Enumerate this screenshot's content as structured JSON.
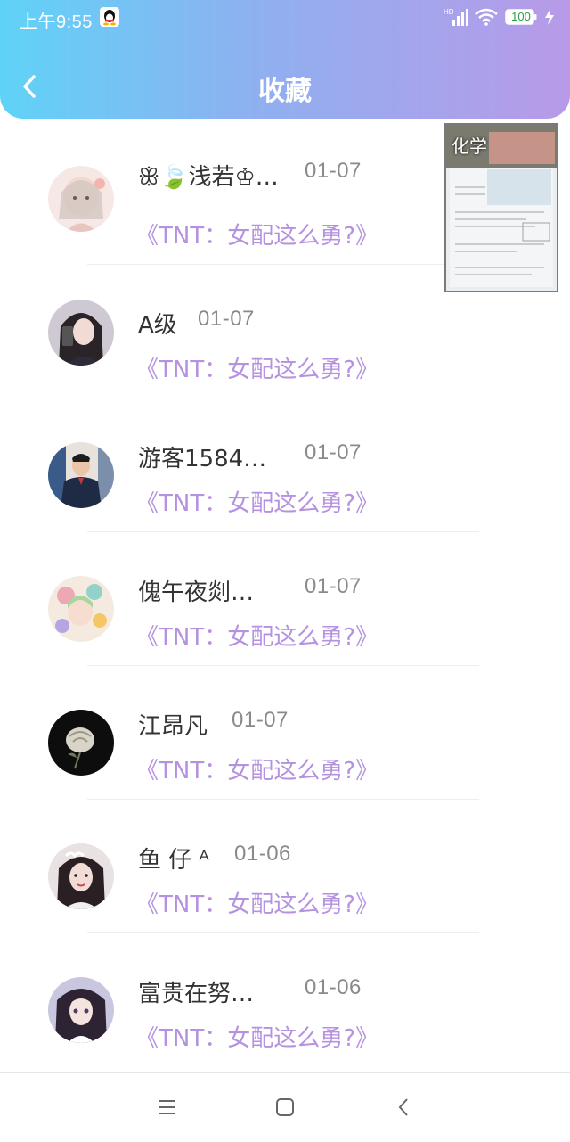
{
  "status_bar": {
    "time": "上午9:55",
    "battery": "100",
    "network": "HD"
  },
  "header": {
    "title": "收藏"
  },
  "items": [
    {
      "name": "ꕥ🍃浅若♔…",
      "date": "01-07",
      "book": "《TNT：女配这么勇?》"
    },
    {
      "name": "A级",
      "date": "01-07",
      "book": "《TNT：女配这么勇?》"
    },
    {
      "name": "游客1584…",
      "date": "01-07",
      "book": "《TNT：女配这么勇?》"
    },
    {
      "name": "傀午夜剡…",
      "date": "01-07",
      "book": "《TNT：女配这么勇?》"
    },
    {
      "name": "江昂凡",
      "date": "01-07",
      "book": "《TNT：女配这么勇?》"
    },
    {
      "name": "鱼 仔 ᴬ",
      "date": "01-06",
      "book": "《TNT：女配这么勇?》"
    },
    {
      "name": "富贵在努…",
      "date": "01-06",
      "book": "《TNT：女配这么勇?》"
    }
  ],
  "floating_window": {
    "label": "化学"
  },
  "colors": {
    "header_start": "#5fd3f7",
    "header_end": "#b89ae8",
    "book_title": "#b592e0"
  },
  "nav_icons": [
    "menu-icon",
    "home-icon",
    "back-icon"
  ]
}
